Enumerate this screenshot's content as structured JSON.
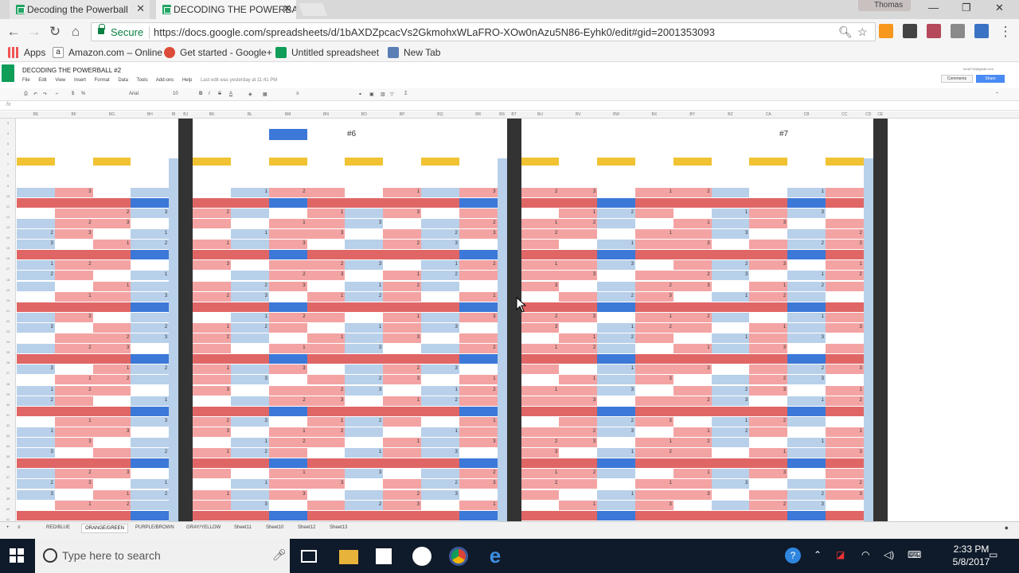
{
  "browser": {
    "tabs": [
      {
        "title": "Decoding the Powerball"
      },
      {
        "title": "DECODING THE POWERBALL"
      }
    ],
    "profile": "Thomas",
    "secure_label": "Secure",
    "url": "https://docs.google.com/spreadsheets/d/1bAXDZpcacVs2GkmohxWLaFRO-XOw0nAzu5N86-Eyhk0/edit#gid=2001353093",
    "bookmarks": [
      {
        "label": "Apps"
      },
      {
        "label": "Amazon.com – Online"
      },
      {
        "label": "Get started - Google+"
      },
      {
        "label": "Untitled spreadsheet"
      },
      {
        "label": "New Tab"
      }
    ]
  },
  "sheets": {
    "title": "DECODING THE POWERBALL #2",
    "menus": [
      "File",
      "Edit",
      "View",
      "Insert",
      "Format",
      "Data",
      "Tools",
      "Add-ons",
      "Help"
    ],
    "last_edit": "Last edit was yesterday at 11:41 PM",
    "account": "tom6718@gmail.com",
    "comments_label": "Comments",
    "share_label": "Share",
    "font_name": "Arial",
    "font_size": "10",
    "fx_label": "fx",
    "section_labels": [
      "#6",
      "#7"
    ],
    "sheet_tabs": [
      "RED/BLUE",
      "ORANGE/GREEN",
      "PURPLE/BROWN",
      "GRAY/YELLOW",
      "Sheet11",
      "Sheet10",
      "Sheet12",
      "Sheet13"
    ],
    "active_sheet_tab": "ORANGE/GREEN",
    "colors": {
      "pink": "#f4a3a3",
      "blue": "#b8d0ea",
      "red": "#e06666",
      "dark_blue": "#3c78d8",
      "orange": "#f1c232",
      "dark_col": "#333333"
    }
  },
  "taskbar": {
    "search_placeholder": "Type here to search",
    "time": "2:33 PM",
    "date": "5/8/2017"
  }
}
